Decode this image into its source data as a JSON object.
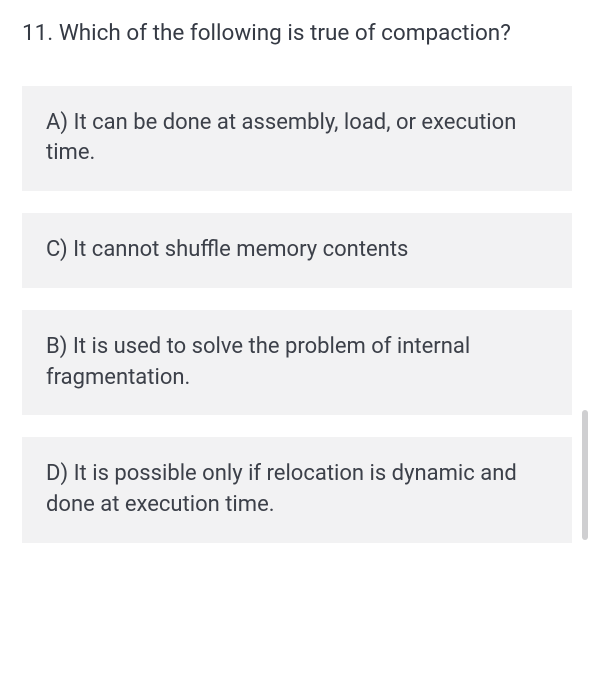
{
  "question": {
    "number": "11.",
    "text": "Which of the following is true of compaction?"
  },
  "options": [
    {
      "label": "A)",
      "text": "It can be done at assembly, load, or execution time."
    },
    {
      "label": "C)",
      "text": "It cannot shuffle memory contents"
    },
    {
      "label": "B)",
      "text": "It is used to solve the problem of internal fragmentation."
    },
    {
      "label": "D)",
      "text": "It is possible only if relocation is dynamic and done at execution time."
    }
  ]
}
